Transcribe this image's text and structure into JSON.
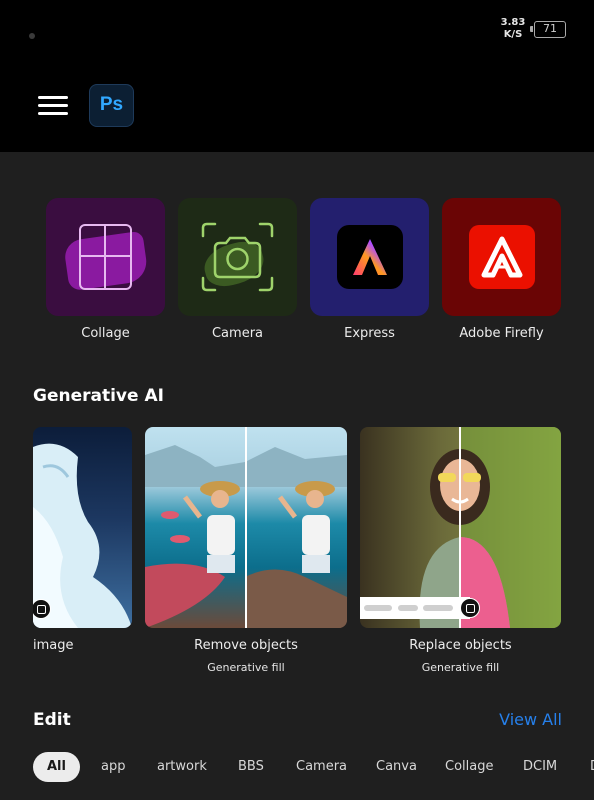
{
  "status_bar": {
    "net_speed_value": "3.83",
    "net_speed_unit": "K/S",
    "battery": "71"
  },
  "app": {
    "logo_text": "Ps",
    "brand_color": "#31a8ff"
  },
  "quick_tools": [
    {
      "label": "Collage",
      "icon": "collage-icon"
    },
    {
      "label": "Camera",
      "icon": "camera-icon"
    },
    {
      "label": "Express",
      "icon": "adobe-express-icon"
    },
    {
      "label": "Adobe Firefly",
      "icon": "adobe-firefly-icon"
    }
  ],
  "generative_ai": {
    "title": "Generative AI",
    "cards": [
      {
        "title": "image",
        "subtitle": ""
      },
      {
        "title": "Remove objects",
        "subtitle": "Generative fill"
      },
      {
        "title": "Replace objects",
        "subtitle": "Generative fill"
      }
    ]
  },
  "edit": {
    "title": "Edit",
    "view_all": "View All",
    "filters": [
      "All",
      "app",
      "artwork",
      "BBS",
      "Camera",
      "Canva",
      "Collage",
      "DCIM",
      "D"
    ],
    "active_filter": "All"
  },
  "colors": {
    "accent_link": "#2680eb",
    "background": "#1f1f1f",
    "top_bar": "#000000"
  }
}
